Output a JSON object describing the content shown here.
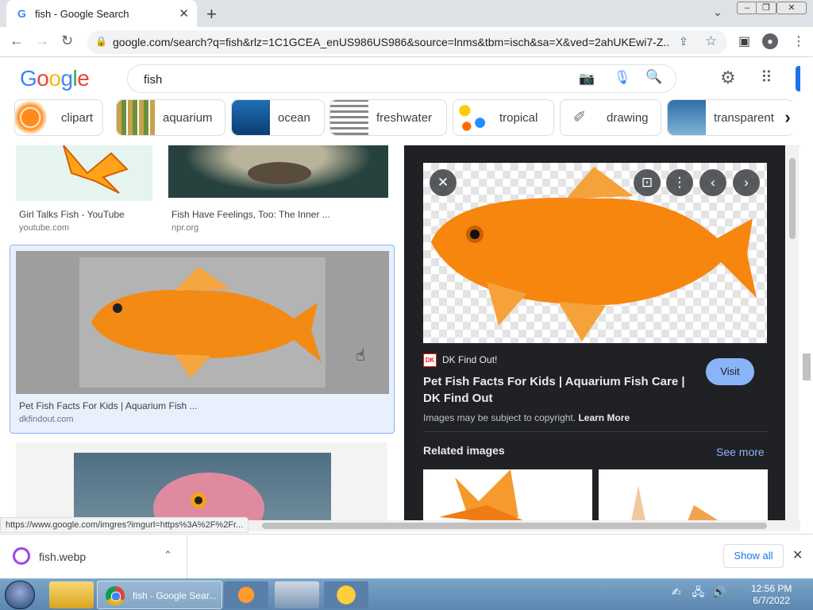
{
  "browser": {
    "tab_title": "fish - Google Search",
    "url": "google.com/search?q=fish&rlz=1C1GCEA_enUS986US986&source=lnms&tbm=isch&sa=X&ved=2ahUKEwi7-Z..."
  },
  "google": {
    "logo": "Google",
    "query": "fish",
    "chips": [
      "clipart",
      "aquarium",
      "ocean",
      "freshwater",
      "tropical",
      "drawing",
      "transparent"
    ]
  },
  "results": [
    {
      "title": "Girl Talks Fish - YouTube",
      "source": "youtube.com"
    },
    {
      "title": "Fish Have Feelings, Too: The Inner ...",
      "source": "npr.org"
    },
    {
      "title": "Pet Fish Facts For Kids | Aquarium Fish ...",
      "source": "dkfindout.com"
    }
  ],
  "panel": {
    "source_icon": "DK",
    "source_name": "DK Find Out!",
    "title": "Pet Fish Facts For Kids | Aquarium Fish Care | DK Find Out",
    "visit_label": "Visit",
    "copyright_text": "Images may be subject to copyright.",
    "learn_more": "Learn More",
    "related_heading": "Related images",
    "see_more": "See more"
  },
  "status_url": "https://www.google.com/imgres?imgurl=https%3A%2F%2Fr...",
  "download": {
    "filename": "fish.webp",
    "show_all": "Show all"
  },
  "taskbar": {
    "chrome_label": "fish - Google Sear...",
    "time": "12:56 PM",
    "date": "6/7/2022"
  },
  "colors": {
    "accent": "#1a73e8",
    "panel_bg": "#202124",
    "visit_button": "#8ab4f8"
  }
}
